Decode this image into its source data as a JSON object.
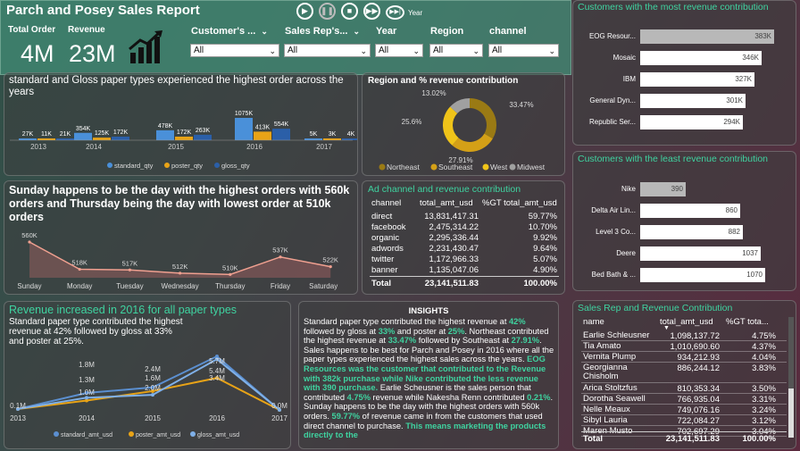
{
  "header": {
    "title": "Parch and Posey Sales Report",
    "total_order_label": "Total Order",
    "revenue_label": "Revenue",
    "total_order_value": "4M",
    "revenue_value": "23M",
    "chart_icon": "growth-chart-icon",
    "year_label": "Year",
    "controls": [
      "play-icon",
      "pause-icon",
      "stop-icon",
      "next-icon"
    ]
  },
  "slicers": [
    {
      "label": "Customer's ...",
      "value": "All"
    },
    {
      "label": "Sales Rep's...",
      "value": "All"
    },
    {
      "label": "Year",
      "value": "All"
    },
    {
      "label": "Region",
      "value": "All"
    },
    {
      "label": "channel",
      "value": "All"
    }
  ],
  "paper_chart": {
    "title": "standard and Gloss paper types experienced the highest order across the years",
    "legend": [
      "standard_qty",
      "poster_qty",
      "gloss_qty"
    ],
    "colors": [
      "#4a90d9",
      "#e8a317",
      "#2b5fa8"
    ]
  },
  "region_chart": {
    "title": "Region and % revenue contribution",
    "legend": [
      "Northeast",
      "Southeast",
      "West",
      "Midwest"
    ],
    "colors": [
      "#9a7a14",
      "#d4a017",
      "#f0c419",
      "#a0a0a0"
    ]
  },
  "weekday_chart": {
    "title": "Sunday happens to be the day with the highest orders with 560k orders and Thursday being the day with lowest order at 510k orders"
  },
  "revenue_chart": {
    "title": "Revenue increased in 2016 for all paper types",
    "subtitle": "Standard paper type contributed the highest revenue at 42% followed by gloss at 33% and poster  at 25%.",
    "legend": [
      "standard_amt_usd",
      "poster_amt_usd",
      "gloss_amt_usd"
    ],
    "colors": [
      "#5b8fd0",
      "#e8a317",
      "#7fb0e8"
    ]
  },
  "channel_table": {
    "title": "Ad channel and revenue contribution",
    "columns": [
      "channel",
      "total_amt_usd",
      "%GT total_amt_usd"
    ],
    "rows": [
      [
        "direct",
        "13,831,417.31",
        "59.77%"
      ],
      [
        "facebook",
        "2,475,314.22",
        "10.70%"
      ],
      [
        "organic",
        "2,295,336.44",
        "9.92%"
      ],
      [
        "adwords",
        "2,231,430.47",
        "9.64%"
      ],
      [
        "twitter",
        "1,172,966.33",
        "5.07%"
      ],
      [
        "banner",
        "1,135,047.06",
        "4.90%"
      ]
    ],
    "total": [
      "Total",
      "23,141,511.83",
      "100.00%"
    ]
  },
  "insights": {
    "title": "INSIGHTS",
    "p1": "Standard paper type contributed the highest revenue at ",
    "p1a": "42%",
    "p2": " followed by gloss at ",
    "p2a": "33%",
    "p3": " and poster  at ",
    "p3a": "25%",
    "p4": ". Northeast contributed the highest revenue at ",
    "p4a": "33.47%",
    "p5": " followed by Southeast at ",
    "p5a": "27.91%",
    "p6": ". Sales happens to be best for Parch and Posey in 2016 where all the paper types experienced the highest sales across the years. ",
    "p6a": "EOG Resources was the customer that contributed to the Revenue with 382k purchase while Nike contributed the less revenue with 390 purchase.",
    "p7": " Earlie Scheusner is the sales person that contributed ",
    "p7a": "4.75%",
    "p8": " revenue while Nakesha Renn contributed ",
    "p8a": "0.21%",
    "p9": ". Sunday happens to be the day with the highest orders with 560k orders. ",
    "p9a": "59.77%",
    "p10": " of revenue came in from the customers that used direct channel to purchase. ",
    "p10a": "This means marketing the products directly to the"
  },
  "top_customers": {
    "title": "Customers with the most revenue contribution",
    "items": [
      {
        "name": "EOG Resour...",
        "value": "383K",
        "num": 383
      },
      {
        "name": "Mosaic",
        "value": "346K",
        "num": 346
      },
      {
        "name": "IBM",
        "value": "327K",
        "num": 327
      },
      {
        "name": "General Dyn...",
        "value": "301K",
        "num": 301
      },
      {
        "name": "Republic Ser...",
        "value": "294K",
        "num": 294
      }
    ]
  },
  "least_customers": {
    "title": "Customers with the least revenue contribution",
    "items": [
      {
        "name": "Nike",
        "value": "390",
        "num": 390
      },
      {
        "name": "Delta Air Lin...",
        "value": "860",
        "num": 860
      },
      {
        "name": "Level 3 Co...",
        "value": "882",
        "num": 882
      },
      {
        "name": "Deere",
        "value": "1037",
        "num": 1037
      },
      {
        "name": "Bed Bath & ...",
        "value": "1070",
        "num": 1070
      }
    ]
  },
  "sales_rep_table": {
    "title": "Sales Rep and Revenue Contribution",
    "columns": [
      "name",
      "total_amt_usd",
      "%GT tota..."
    ],
    "rows": [
      [
        "Earlie Schleusner",
        "1,098,137.72",
        "4.75%"
      ],
      [
        "Tia Amato",
        "1,010,690.60",
        "4.37%"
      ],
      [
        "Vernita Plump",
        "934,212.93",
        "4.04%"
      ],
      [
        "Georgianna Chisholm",
        "886,244.12",
        "3.83%"
      ],
      [
        "Arica Stoltzfus",
        "810,353.34",
        "3.50%"
      ],
      [
        "Dorotha Seawell",
        "766,935.04",
        "3.31%"
      ],
      [
        "Nelle Meaux",
        "749,076.16",
        "3.24%"
      ],
      [
        "Sibyl Lauria",
        "722,084.27",
        "3.12%"
      ],
      [
        "Maren Musto",
        "702,697.29",
        "3.04%"
      ]
    ],
    "total": [
      "Total",
      "23,141,511.83",
      "100.00%"
    ]
  },
  "chart_data": [
    {
      "type": "bar",
      "title": "standard and Gloss paper types experienced the highest order across the years",
      "categories": [
        "2013",
        "2014",
        "2015",
        "2016",
        "2017"
      ],
      "series": [
        {
          "name": "standard_qty",
          "values": [
            27,
            354,
            478,
            1075,
            5
          ],
          "labels": [
            "27K",
            "354K",
            "478K",
            "1075K",
            "5K"
          ]
        },
        {
          "name": "poster_qty",
          "values": [
            11,
            125,
            172,
            413,
            3
          ],
          "labels": [
            "11K",
            "125K",
            "172K",
            "413K",
            "3K"
          ]
        },
        {
          "name": "gloss_qty",
          "values": [
            21,
            172,
            263,
            554,
            4
          ],
          "labels": [
            "21K",
            "172K",
            "263K",
            "554K",
            "4K"
          ]
        }
      ]
    },
    {
      "type": "pie",
      "title": "Region and % revenue contribution",
      "categories": [
        "Northeast",
        "Southeast",
        "West",
        "Midwest"
      ],
      "values": [
        33.47,
        27.91,
        25.6,
        13.02
      ],
      "labels": [
        "33.47%",
        "27.91%",
        "25.6%",
        "13.02%"
      ]
    },
    {
      "type": "area",
      "title": "Sunday happens to be the day with the highest orders with 560k orders and Thursday being the day with lowest order at 510k orders",
      "categories": [
        "Sunday",
        "Monday",
        "Tuesday",
        "Wednesday",
        "Thursday",
        "Friday",
        "Saturday"
      ],
      "values": [
        560,
        518,
        517,
        512,
        510,
        537,
        522
      ],
      "labels": [
        "560K",
        "518K",
        "517K",
        "512K",
        "510K",
        "537K",
        "522K"
      ]
    },
    {
      "type": "line",
      "title": "Revenue increased in 2016 for all paper types",
      "categories": [
        "2013",
        "2014",
        "2015",
        "2016",
        "2017"
      ],
      "series": [
        {
          "name": "standard_amt_usd",
          "values": [
            0.1,
            1.8,
            2.4,
            5.7,
            0.0
          ],
          "labels": [
            "0.1M",
            "1.8M",
            "2.4M",
            "5.7M",
            "0.0M"
          ]
        },
        {
          "name": "poster_amt_usd",
          "values": [
            0.1,
            1.0,
            2.0,
            3.4,
            0.0
          ],
          "labels": [
            "",
            "1.0M",
            "2.0M",
            "3.4M",
            ""
          ]
        },
        {
          "name": "gloss_amt_usd",
          "values": [
            0.1,
            1.3,
            1.6,
            5.4,
            0.0
          ],
          "labels": [
            "",
            "1.3M",
            "1.6M",
            "5.4M",
            ""
          ]
        }
      ]
    }
  ]
}
